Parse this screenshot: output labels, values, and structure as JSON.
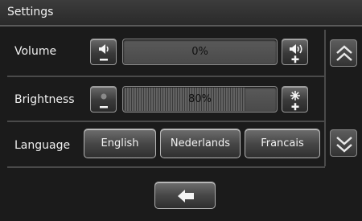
{
  "title": "Settings",
  "volume": {
    "label": "Volume",
    "value_text": "0%",
    "level": 0,
    "decrease_icon": "volume-down-icon",
    "increase_icon": "volume-up-icon"
  },
  "brightness": {
    "label": "Brightness",
    "value_text": "80%",
    "level": 0.8,
    "decrease_icon": "brightness-down-icon",
    "increase_icon": "brightness-up-icon"
  },
  "language": {
    "label": "Language",
    "options": [
      "English",
      "Nederlands",
      "Francais"
    ]
  },
  "navigation": {
    "scroll_up_icon": "double-chevron-up-icon",
    "scroll_down_icon": "double-chevron-down-icon",
    "back_icon": "back-arrow-icon"
  },
  "colors": {
    "background": "#1b1b1b",
    "text": "#f0f0f0",
    "divider": "#4a4a4a"
  }
}
